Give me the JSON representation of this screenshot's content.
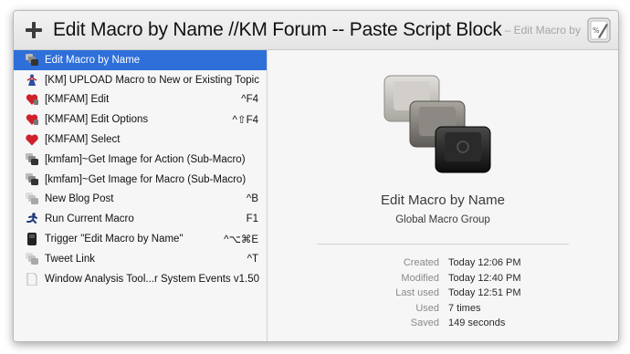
{
  "window": {
    "title": "Edit Macro by Name //KM Forum -- Paste Script Block",
    "subtitle": "– Edit Macro by",
    "app_icon": "script-editor-icon"
  },
  "macros": [
    {
      "label": "Edit Macro by Name",
      "shortcut": "",
      "icon": "km-keys-icon",
      "selected": true
    },
    {
      "label": "[KM] UPLOAD Macro to New or Existing Topic",
      "shortcut": "",
      "icon": "upload-figure-icon"
    },
    {
      "label": "[KMFAM] Edit",
      "shortcut": "^F4",
      "icon": "heart-edit-icon"
    },
    {
      "label": "[KMFAM] Edit Options",
      "shortcut": "^⇧F4",
      "icon": "heart-edit-icon"
    },
    {
      "label": "[KMFAM] Select",
      "shortcut": "",
      "icon": "heart-icon"
    },
    {
      "label": "[kmfam]~Get Image for Action (Sub-Macro)",
      "shortcut": "",
      "icon": "km-keys-icon"
    },
    {
      "label": "[kmfam]~Get Image for Macro (Sub-Macro)",
      "shortcut": "",
      "icon": "km-keys-icon"
    },
    {
      "label": "New Blog Post",
      "shortcut": "^B",
      "icon": "km-keys-light-icon"
    },
    {
      "label": "Run Current Macro",
      "shortcut": "F1",
      "icon": "running-man-icon"
    },
    {
      "label": "Trigger \"Edit Macro by Name\"",
      "shortcut": "^⌥⌘E",
      "icon": "trigger-device-icon"
    },
    {
      "label": "Tweet Link",
      "shortcut": "^T",
      "icon": "km-keys-light-icon"
    },
    {
      "label": "Window Analysis Tool...r System Events v1.50",
      "shortcut": "",
      "icon": "document-icon"
    }
  ],
  "detail": {
    "name": "Edit Macro by Name",
    "group": "Global Macro Group",
    "icon": "km-keys-large-icon",
    "meta": [
      {
        "key": "Created",
        "value": "Today 12:06 PM"
      },
      {
        "key": "Modified",
        "value": "Today 12:40 PM"
      },
      {
        "key": "Last used",
        "value": "Today 12:51 PM"
      },
      {
        "key": "Used",
        "value": "7 times"
      },
      {
        "key": "Saved",
        "value": "149 seconds"
      }
    ]
  },
  "colors": {
    "selection": "#2e6fd9",
    "heart": "#d0202a"
  }
}
